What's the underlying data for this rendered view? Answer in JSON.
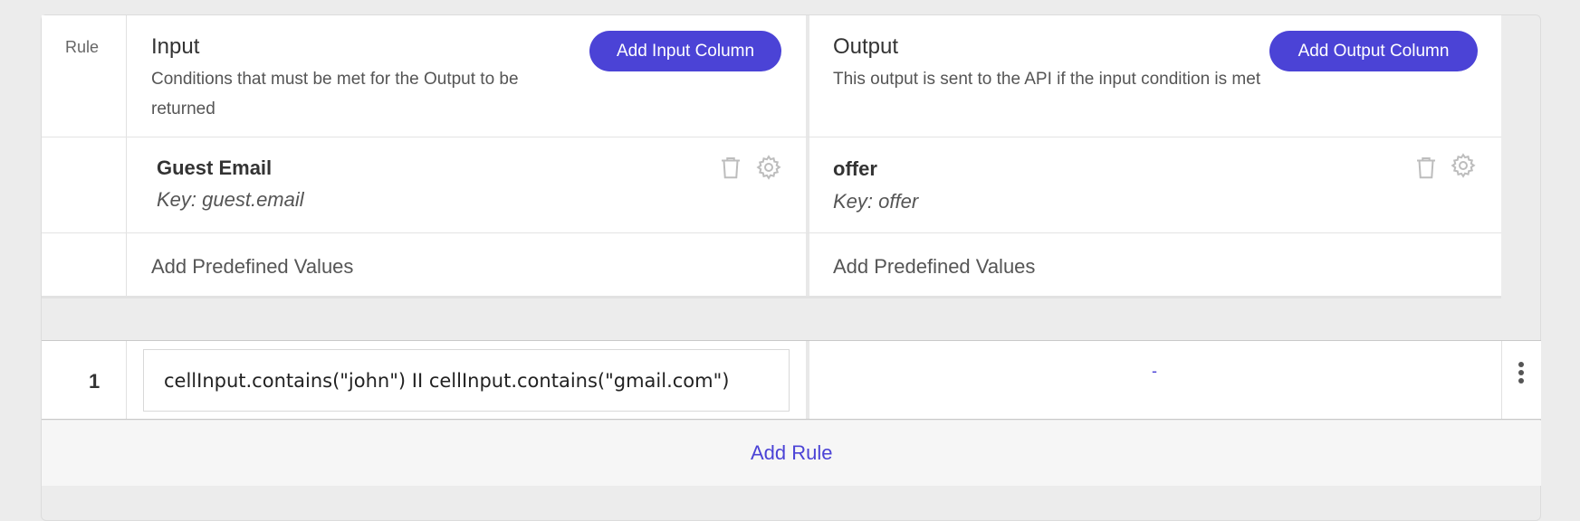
{
  "header": {
    "rule_label": "Rule",
    "input": {
      "title": "Input",
      "description": "Conditions that must be met for the Output to be returned",
      "add_button": "Add Input Column"
    },
    "output": {
      "title": "Output",
      "description": "This output is sent to the API if the input condition is met",
      "add_button": "Add Output Column"
    }
  },
  "columns": {
    "input": {
      "name": "Guest Email",
      "key": "Key: guest.email",
      "predefined": "Add Predefined Values"
    },
    "output": {
      "name": "offer",
      "key": "Key: offer",
      "predefined": "Add Predefined Values"
    }
  },
  "rules": [
    {
      "number": "1",
      "condition": "cellInput.contains(\"john\") II cellInput.contains(\"gmail.com\")",
      "output": "-"
    }
  ],
  "footer": {
    "add_rule": "Add Rule"
  },
  "colors": {
    "accent": "#4b43d6",
    "icon_gray": "#bdbdbd"
  }
}
